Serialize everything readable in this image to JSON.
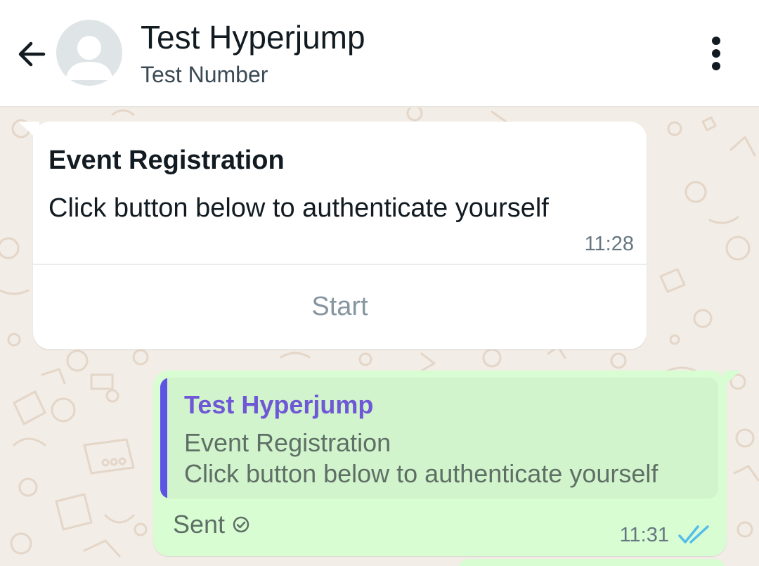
{
  "header": {
    "contact_name": "Test Hyperjump",
    "contact_subtitle": "Test Number",
    "back_icon": "arrow-left-icon",
    "menu_icon": "more-vertical-icon",
    "avatar_icon": "default-avatar-icon"
  },
  "messages": {
    "incoming": {
      "title": "Event Registration",
      "body": "Click button below to authenticate yourself",
      "time": "11:28",
      "button_label": "Start"
    },
    "outgoing": {
      "quoted_author": "Test Hyperjump",
      "quoted_line1": "Event Registration",
      "quoted_line2": "Click button below to authenticate yourself",
      "status_label": "Sent",
      "status_icon": "check-circle-icon",
      "time": "11:31",
      "read_icon": "double-check-icon"
    }
  },
  "colors": {
    "outgoing_bubble": "#d9fdd3",
    "quote_bar": "#5e54e3",
    "quote_author": "#6f58d6",
    "read_ticks": "#53bdeb",
    "chat_background": "#efeae2"
  }
}
